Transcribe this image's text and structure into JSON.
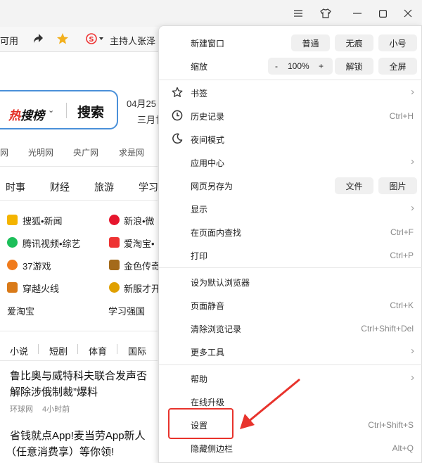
{
  "window": {
    "controls": [
      "menu-icon",
      "skin-icon",
      "minimize-icon",
      "maximize-icon",
      "close-icon"
    ]
  },
  "bookmarks": {
    "partial_item": "可用",
    "news_item": "主持人张泽"
  },
  "search": {
    "logo_part1": "热",
    "logo_part2": "搜榜",
    "chevron": "⌄",
    "button": "搜索"
  },
  "date": {
    "line1": "04月25",
    "line2": "三月廿"
  },
  "nav_links": [
    "网",
    "光明网",
    "央广网",
    "求是网"
  ],
  "categories": [
    "时事",
    "财经",
    "旅游",
    "学习"
  ],
  "sites": [
    {
      "name": "搜狐•新闻",
      "color": "#f4b400"
    },
    {
      "name": "新浪•微",
      "color": "#e6162d"
    },
    {
      "name": "腾讯视频•综艺",
      "color": "#1cbf5a"
    },
    {
      "name": "爱淘宝•",
      "color": "#e33"
    },
    {
      "name": "37游戏",
      "color": "#f07b1c"
    },
    {
      "name": "金色传奇",
      "color": "#a46a1a"
    },
    {
      "name": "穿越火线",
      "color": "#d97a18"
    },
    {
      "name": "新服才开",
      "color": "#e0a000"
    },
    {
      "name": "爱淘宝",
      "color": ""
    },
    {
      "name": "学习强国",
      "color": ""
    }
  ],
  "content_tabs": [
    "小说",
    "短剧",
    "体育",
    "国际"
  ],
  "news": [
    {
      "line1": "鲁比奥与威特科夫联合发声否",
      "line2": "解除涉俄制裁”爆料",
      "source": "环球网",
      "time": "4小时前"
    },
    {
      "line1": "省钱就点App!麦当劳App新人",
      "line2": "（任意消费享）等你领!"
    }
  ],
  "menu": {
    "new_window": {
      "label": "新建窗口",
      "options": [
        "普通",
        "无痕",
        "小号"
      ]
    },
    "zoom": {
      "label": "缩放",
      "minus": "-",
      "value": "100%",
      "plus": "+",
      "unlock": "解锁",
      "fullscreen": "全屏"
    },
    "bookmarks": {
      "label": "书签"
    },
    "history": {
      "label": "历史记录",
      "shortcut": "Ctrl+H"
    },
    "night_mode": {
      "label": "夜间模式"
    },
    "app_center": {
      "label": "应用中心"
    },
    "save_as": {
      "label": "网页另存为",
      "options": [
        "文件",
        "图片"
      ]
    },
    "display": {
      "label": "显示"
    },
    "find": {
      "label": "在页面内查找",
      "shortcut": "Ctrl+F"
    },
    "print": {
      "label": "打印",
      "shortcut": "Ctrl+P"
    },
    "default_browser": {
      "label": "设为默认浏览器"
    },
    "mute": {
      "label": "页面静音",
      "shortcut": "Ctrl+K"
    },
    "clear_history": {
      "label": "清除浏览记录",
      "shortcut": "Ctrl+Shift+Del"
    },
    "more_tools": {
      "label": "更多工具"
    },
    "help": {
      "label": "帮助"
    },
    "upgrade": {
      "label": "在线升级"
    },
    "settings": {
      "label": "设置",
      "shortcut": "Ctrl+Shift+S"
    },
    "hide_sidebar": {
      "label": "隐藏侧边栏",
      "shortcut": "Alt+Q"
    }
  },
  "annotation": {
    "highlight_color": "#e8332c"
  }
}
